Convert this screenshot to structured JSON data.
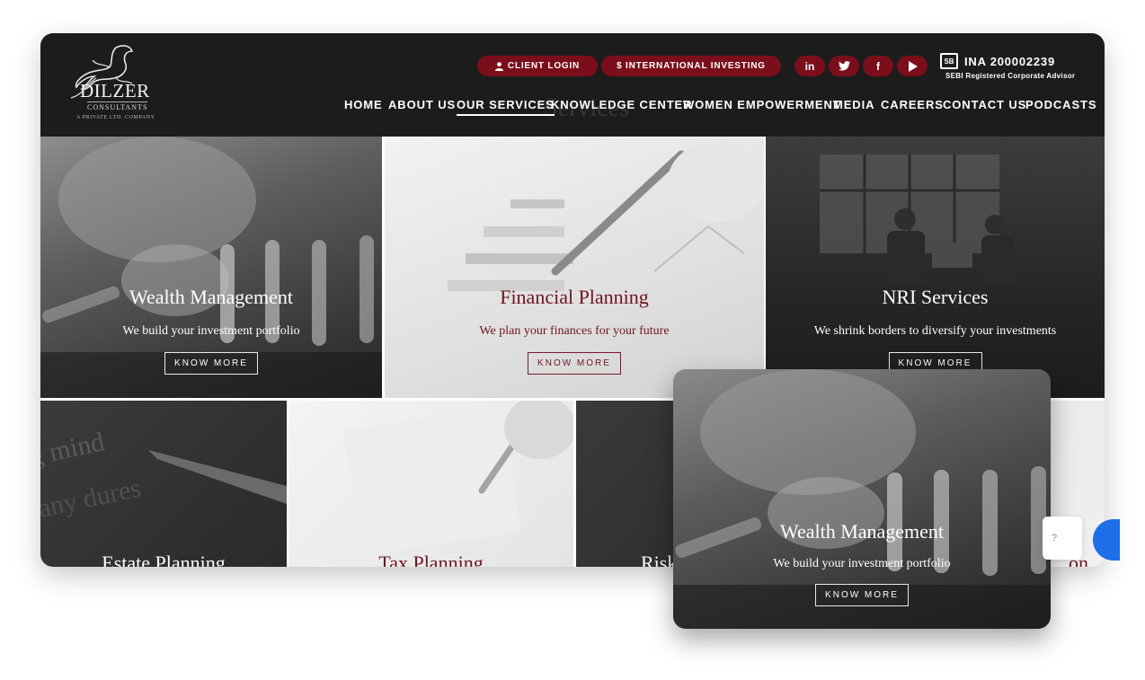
{
  "header": {
    "logo_name": "DILZER",
    "logo_sub": "CONSULTANTS",
    "logo_tag": "A PRIVATE LTD. COMPANY",
    "client_login": "CLIENT LOGIN",
    "intl_investing": "$ INTERNATIONAL INVESTING",
    "social": {
      "linkedin": "in",
      "twitter": "t",
      "facebook": "f",
      "youtube": "▶"
    },
    "ina": "INA 200002239",
    "sebi": "SEBI Registered Corporate Advisor"
  },
  "nav": [
    "HOME",
    "ABOUT US",
    "OUR SERVICES",
    "KNOWLEDGE CENTER",
    "WOMEN EMPOWERMENT",
    "MEDIA",
    "CAREERS",
    "CONTACT US",
    "PODCASTS"
  ],
  "ghost_title": "Services",
  "services": [
    {
      "title": "Wealth Management",
      "desc": "We build your investment portfolio",
      "btn": "KNOW MORE"
    },
    {
      "title": "Financial Planning",
      "desc": "We plan your finances for your future",
      "btn": "KNOW MORE"
    },
    {
      "title": "NRI Services",
      "desc": "We shrink borders to diversify your investments",
      "btn": "KNOW MORE"
    },
    {
      "title": "Estate Planning"
    },
    {
      "title": "Tax Planning"
    },
    {
      "title": "Risk"
    },
    {
      "title": "on"
    }
  ],
  "popup": {
    "title": "Wealth Management",
    "desc": "We build your investment portfolio",
    "btn": "KNOW MORE"
  },
  "chat_hint": "?"
}
